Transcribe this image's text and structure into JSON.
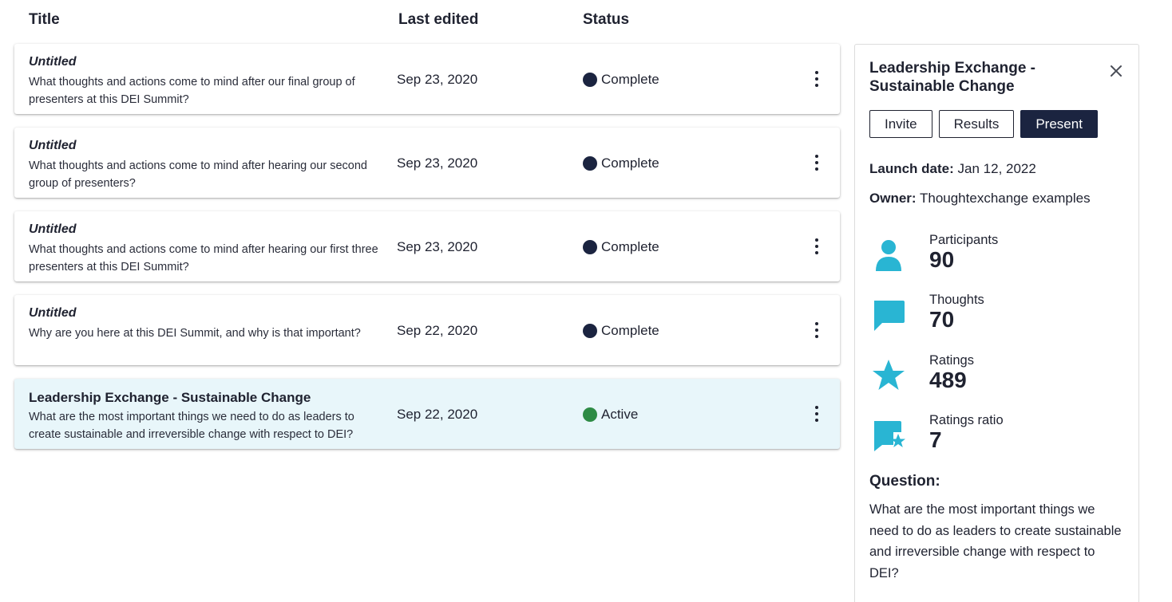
{
  "columns": {
    "title": "Title",
    "last_edited": "Last edited",
    "status": "Status"
  },
  "exchanges": [
    {
      "title": "Untitled",
      "question": "What thoughts and actions come to mind after our final group of presenters at this DEI Summit?",
      "date": "Sep 23, 2020",
      "status": "Complete"
    },
    {
      "title": "Untitled",
      "question": "What thoughts and actions come to mind after hearing our second group of presenters?",
      "date": "Sep 23, 2020",
      "status": "Complete"
    },
    {
      "title": "Untitled",
      "question": "What thoughts and actions come to mind after hearing our first three presenters at this DEI Summit?",
      "date": "Sep 23, 2020",
      "status": "Complete"
    },
    {
      "title": "Untitled",
      "question": "Why are you here at this DEI Summit, and why is that important?",
      "date": "Sep 22, 2020",
      "status": "Complete"
    },
    {
      "title": "Leadership Exchange - Sustainable Change",
      "question": "What are the most important things we need to do as leaders to create sustainable and irreversible change with respect to DEI?",
      "date": "Sep 22, 2020",
      "status": "Active"
    }
  ],
  "colors": {
    "complete": "#1b2440",
    "active": "#2e8b45",
    "accent": "#29b5d3",
    "selected_bg": "#e8f6fa"
  },
  "panel": {
    "title": "Leadership Exchange - Sustainable Change",
    "buttons": {
      "invite": "Invite",
      "results": "Results",
      "present": "Present"
    },
    "launch_label": "Launch date:",
    "launch_value": "Jan 12, 2022",
    "owner_label": "Owner:",
    "owner_value": "Thoughtexchange examples",
    "stats": [
      {
        "label": "Participants",
        "value": "90",
        "icon": "person-icon"
      },
      {
        "label": "Thoughts",
        "value": "70",
        "icon": "speech-bubble-icon"
      },
      {
        "label": "Ratings",
        "value": "489",
        "icon": "star-icon"
      },
      {
        "label": "Ratings ratio",
        "value": "7",
        "icon": "bubble-star-icon"
      }
    ],
    "question_label": "Question:",
    "question_text": "What are the most important things we need to do as leaders to create sustainable and irreversible change with respect to DEI?"
  }
}
